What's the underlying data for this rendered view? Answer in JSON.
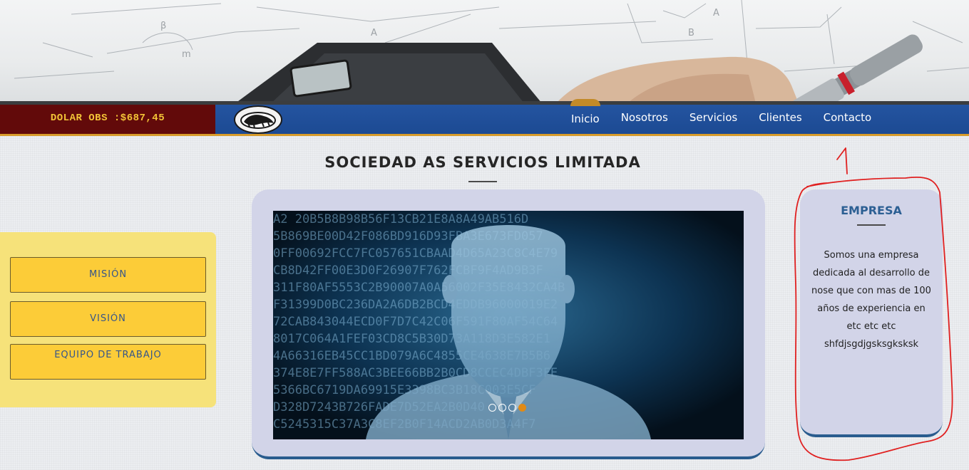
{
  "topbar": {
    "dolar_label": "DOLAR OBS :$687,45"
  },
  "nav": {
    "items": [
      {
        "label": "Inicio"
      },
      {
        "label": "Nosotros"
      },
      {
        "label": "Servicios"
      },
      {
        "label": "Clientes"
      },
      {
        "label": "Contacto"
      }
    ],
    "active": "Inicio"
  },
  "main": {
    "title": "SOCIEDAD AS SERVICIOS LIMITADA"
  },
  "side_menu": {
    "buttons": [
      {
        "label": "MISIÓN"
      },
      {
        "label": "VISIÓN"
      },
      {
        "label": "EQUIPO DE TRABAJO"
      }
    ]
  },
  "slider": {
    "slide_count": 4,
    "active_slide": 4,
    "hex_rows": [
      "A2 20B5B8B98B56F13CB21E8A8A49AB516D",
      "5B869BE00D42F086BD916D93FBA3E673FD057",
      "0FF00692FCC7FC057651CBAAD4D65A23C8C4E79",
      "CB8D42FF00E3D0F26907F762FCBF9F4AD9B3F",
      "311F80AF5553C2B90007A0A56002F35E8432CA4B",
      "F31399D0BC236DA2A6DB2BCD4EDDB96000019E2",
      "72CAB843044ECD0F7D7C42C06F591F80AF54C64",
      "8017C064A1FEF03CD8C5B30D73A118D3E582E1",
      "4A66316EB45CC1BD079A6C4855CE4638E7B5B6",
      "374E8E7FF588AC3BEE66BB2B0CD8CCEC4DBF3FE",
      "5366BC6719DA69915E3398BC3B18C003E5CF",
      "D328D7243B726FADE7D52EA2B0D40",
      "C5245315C37A3C8EF2B0F14ACD2AB0D3A4F7"
    ]
  },
  "empresa": {
    "title": "EMPRESA",
    "text": "Somos una empresa dedicada al desarrollo de nose que con mas de 100 años de experiencia en etc etc etc shfdjsgdjgsksgksksk"
  },
  "colors": {
    "nav_blue": "#1f4f9a",
    "dolar_bg": "#620a0a",
    "dolar_text": "#f3c437",
    "accent_orange": "#d79b2a",
    "menu_yellow": "#fccc38",
    "panel_lavender": "#d2d4e8",
    "annotation_red": "#e02020"
  },
  "icons": [
    "logo-icon"
  ]
}
